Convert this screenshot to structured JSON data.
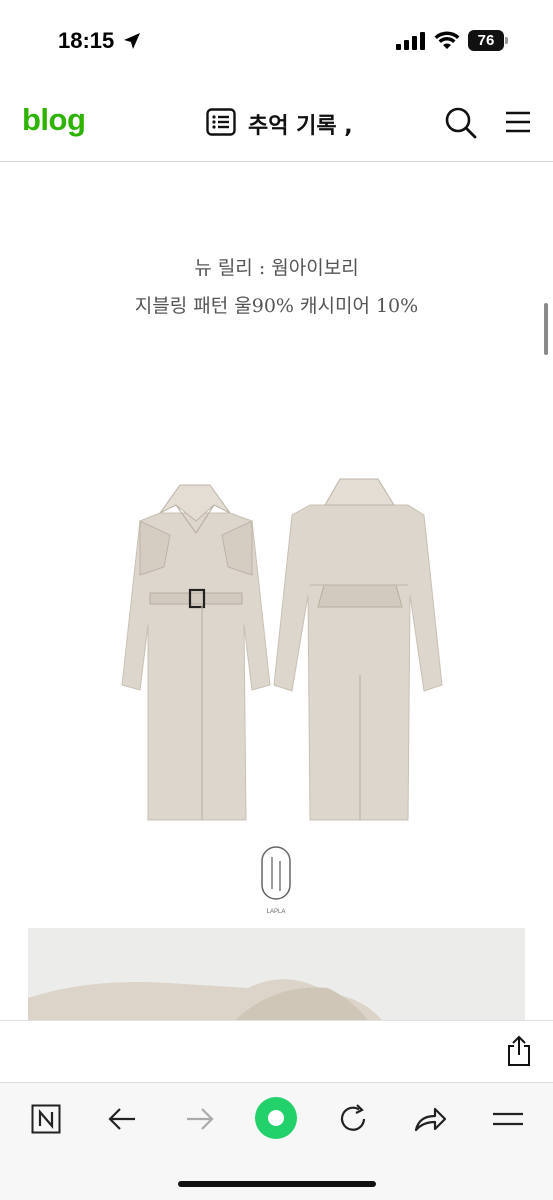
{
  "status_bar": {
    "time": "18:15",
    "battery": "76",
    "icons": [
      "location-arrow-icon",
      "cellular-signal-icon",
      "wifi-icon",
      "battery-icon"
    ]
  },
  "header": {
    "logo": "blog",
    "title": "추억 기록 ,",
    "icons": [
      "list-icon",
      "search-icon",
      "menu-icon"
    ]
  },
  "content": {
    "caption_line1": "뉴 릴리 : 웜아이보리",
    "caption_line2": "지블링 패턴 울90% 캐시미어 10%",
    "brand_logo_text": "LAPLA"
  },
  "share_bar": {
    "icons": [
      "share-icon"
    ]
  },
  "browser_toolbar": {
    "icons": [
      "naver-n-icon",
      "back-arrow-icon",
      "forward-arrow-icon",
      "green-home-button",
      "reload-icon",
      "share-arrow-icon",
      "more-menu-icon"
    ]
  },
  "colors": {
    "brand_green": "#2db400",
    "action_green": "#22d16a",
    "coat_beige": "#ddd6cc",
    "caption_gray": "#555555"
  }
}
